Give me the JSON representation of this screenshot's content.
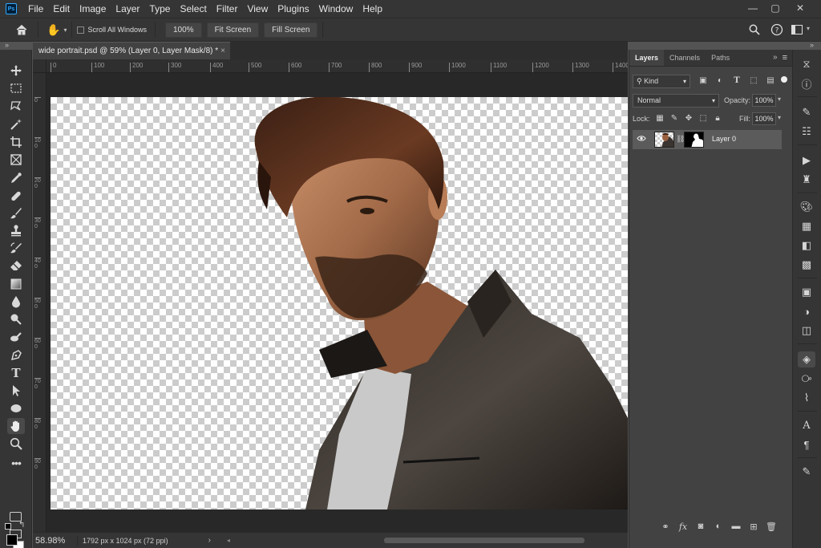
{
  "app": {
    "logo": "Ps"
  },
  "menu": [
    "File",
    "Edit",
    "Image",
    "Layer",
    "Type",
    "Select",
    "Filter",
    "View",
    "Plugins",
    "Window",
    "Help"
  ],
  "window_controls": {
    "minimize": "—",
    "maximize": "▢",
    "close": "✕"
  },
  "options_bar": {
    "scroll_all_windows": "Scroll All Windows",
    "zoom_100": "100%",
    "fit_screen": "Fit Screen",
    "fill_screen": "Fill Screen"
  },
  "collapse_glyph": "»",
  "document_tab": {
    "title": "wide portrait.psd @ 59% (Layer 0, Layer Mask/8) *",
    "close": "×"
  },
  "rulers": {
    "top": [
      "0",
      "100",
      "200",
      "300",
      "400",
      "500",
      "600",
      "700",
      "800",
      "900",
      "1000",
      "1100",
      "1200",
      "1300",
      "1400"
    ],
    "left": [
      "0",
      "100",
      "200",
      "300",
      "400",
      "500",
      "600",
      "700",
      "800",
      "900"
    ]
  },
  "status_bar": {
    "zoom": "58.98%",
    "doc_info": "1792 px x 1024 px (72 ppi)",
    "arrow": "›"
  },
  "layers_panel": {
    "tabs": [
      "Layers",
      "Channels",
      "Paths"
    ],
    "kind_filter": "Kind",
    "blend_mode": "Normal",
    "opacity_label": "Opacity:",
    "opacity_value": "100%",
    "lock_label": "Lock:",
    "fill_label": "Fill:",
    "fill_value": "100%",
    "layer": {
      "name": "Layer 0",
      "visible": true
    }
  },
  "icons": {
    "tools": [
      "move-icon",
      "marquee-icon",
      "lasso-icon",
      "magic-wand-icon",
      "crop-icon",
      "frame-icon",
      "eyedropper-icon",
      "healing-brush-icon",
      "brush-icon",
      "clone-stamp-icon",
      "history-brush-icon",
      "eraser-icon",
      "gradient-icon",
      "blur-icon",
      "dodge-icon",
      "smudge-icon",
      "pen-icon",
      "type-icon",
      "path-selection-icon",
      "ellipse-icon",
      "hand-icon",
      "zoom-icon",
      "more-tools-icon"
    ]
  },
  "colors": {
    "foreground": "#000000",
    "background": "#ffffff",
    "ui_dark": "#353535",
    "panel": "#424242"
  }
}
